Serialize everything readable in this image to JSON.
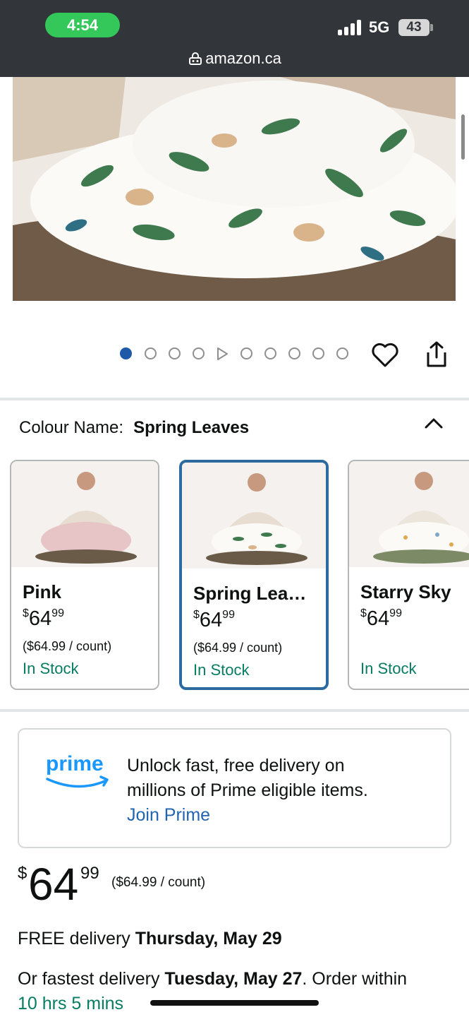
{
  "status": {
    "time": "4:54",
    "network": "5G",
    "battery": "43"
  },
  "browser": {
    "url": "amazon.ca"
  },
  "carousel": {
    "image_count": 10,
    "active_index": 0,
    "video_index": 4
  },
  "colour": {
    "label": "Colour Name:",
    "selected": "Spring Leaves",
    "options": [
      {
        "name": "Pink",
        "currency": "$",
        "price_whole": "64",
        "price_fraction": "99",
        "unit_price": "($64.99 / count)",
        "stock": "In Stock"
      },
      {
        "name": "Spring Lea…",
        "currency": "$",
        "price_whole": "64",
        "price_fraction": "99",
        "unit_price": "($64.99 / count)",
        "stock": "In Stock"
      },
      {
        "name": "Starry Sky",
        "currency": "$",
        "price_whole": "64",
        "price_fraction": "99",
        "unit_price": "",
        "stock": "In Stock"
      }
    ]
  },
  "prime": {
    "logo": "prime",
    "line1": "Unlock fast, free delivery on",
    "line2": "millions of Prime eligible items.",
    "link": "Join Prime"
  },
  "price": {
    "currency": "$",
    "whole": "64",
    "fraction": "99",
    "unit": "($64.99 / count)"
  },
  "delivery": {
    "free_prefix": "FREE delivery ",
    "free_date": "Thursday, May 29",
    "fastest_prefix": "Or fastest delivery ",
    "fastest_date": "Tuesday, May 27",
    "order_within": ". Order within",
    "countdown": "10 hrs 5 mins"
  },
  "colors": {
    "accent": "#2d6aa0",
    "in_stock": "#067d62",
    "link": "#2264b0",
    "prime_blue": "#1a98ff"
  }
}
